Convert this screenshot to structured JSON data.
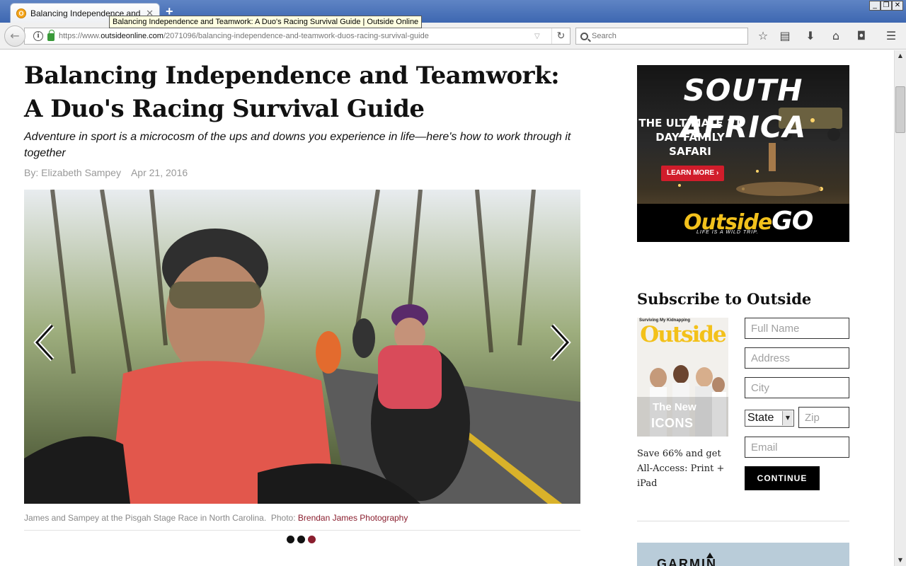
{
  "browser": {
    "tab_title": "Balancing Independence and ...",
    "tab_close": "✕",
    "new_tab": "+",
    "tooltip": "Balancing Independence and Teamwork: A Duo's Racing Survival Guide | Outside Online",
    "url_prefix": "https://www.",
    "url_domain": "outsideonline.com",
    "url_path": "/2071096/balancing-independence-and-teamwork-duos-racing-survival-guide",
    "search_placeholder": "Search",
    "icons": [
      "bookmark-star-icon",
      "reading-list-icon",
      "download-icon",
      "home-icon",
      "pocket-icon",
      "menu-icon"
    ]
  },
  "article": {
    "headline": "Balancing Independence and Teamwork: A Duo's Racing Survival Guide",
    "dek": "Adventure in sport is a microcosm of the ups and downs you experience in life—here's how to work through it together",
    "byline": "By: Elizabeth Sampey",
    "date": "Apr 21, 2016",
    "caption": "James and Sampey at the Pisgah Stage Race in North Carolina.",
    "photo_label": "Photo:",
    "photo_credit": "Brendan James Photography",
    "slides": 3,
    "active_slide": 3
  },
  "ad": {
    "title": "SOUTH AFRICA",
    "subtitle": "THE ULTIMATE 11 DAY FAMILY SAFARI",
    "cta": "LEARN MORE ›",
    "logo_outside": "Outside",
    "logo_go": "GO",
    "tagline": "LIFE IS A WILD TRIP."
  },
  "subscribe": {
    "title": "Subscribe to Outside",
    "cover_top": "Surviving My Kidnapping",
    "cover_masthead": "Outside",
    "cover_line1": "The New",
    "cover_line2": "ICONS",
    "offer": "Save 66% and get All-Access: Print + iPad",
    "fields": {
      "full_name": "Full Name",
      "address": "Address",
      "city": "City",
      "state": "State",
      "zip": "Zip",
      "email": "Email"
    },
    "continue_label": "CONTINUE"
  },
  "garmin_ad": {
    "logo": "GARMIN"
  },
  "colors": {
    "accent": "#8a1e2e",
    "ad_red": "#d11d2b",
    "outside_yellow": "#f2c11c"
  }
}
